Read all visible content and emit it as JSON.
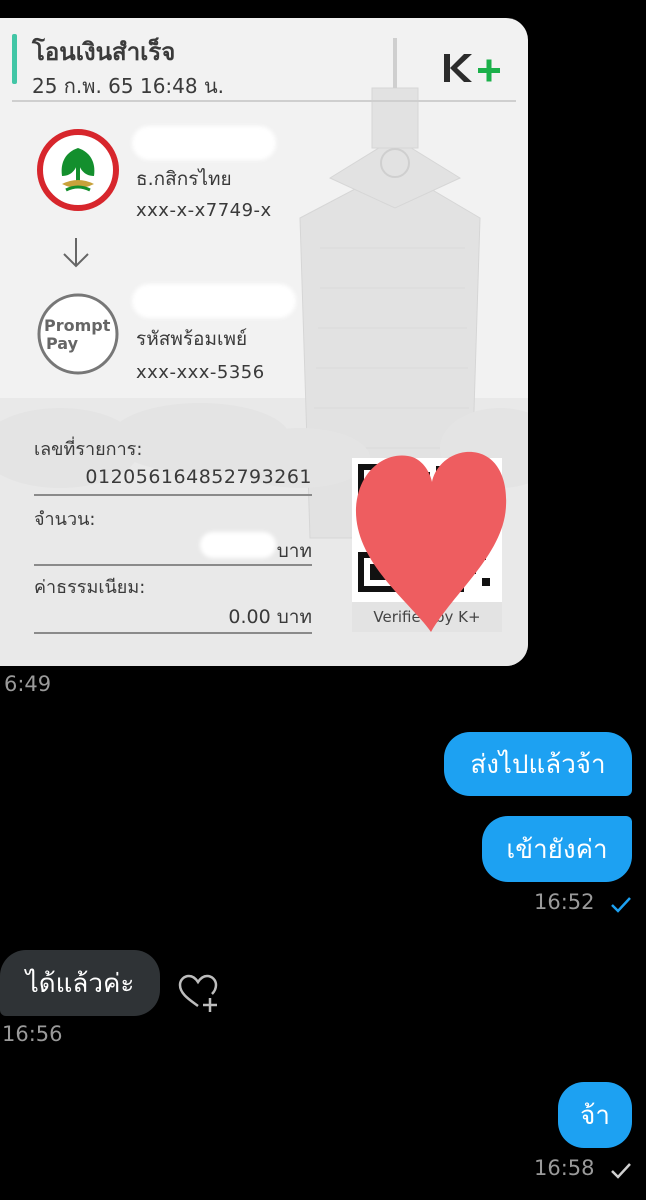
{
  "slip": {
    "title": "โอนเงินสำเร็จ",
    "datetime": "25 ก.พ. 65  16:48 น.",
    "app_logo": "K+",
    "sender": {
      "bank": "ธ.กสิกรไทย",
      "account": "xxx-x-x7749-x",
      "logo_icon": "kbank-logo-icon"
    },
    "receiver": {
      "bank": "รหัสพร้อมเพย์",
      "account": "xxx-xxx-5356",
      "logo_text_1": "Prompt",
      "logo_text_2": "Pay"
    },
    "ref_label": "เลขที่รายการ:",
    "ref_value": "012056164852793261",
    "amount_label": "จำนวน:",
    "amount_unit": "บาท",
    "fee_label": "ค่าธรรมเนียม:",
    "fee_value": "0.00 บาท",
    "verified": "Verified by K+",
    "colors": {
      "accent": "#42c6a6",
      "kbank_green": "#138f2d",
      "kbank_red": "#d7262c",
      "heart": "#ee5d60"
    }
  },
  "chat": {
    "slip_time": "6:49",
    "messages": [
      {
        "from": "me",
        "text": "ส่งไปแล้วจ้า"
      },
      {
        "from": "me",
        "text": "เข้ายังค่า"
      },
      {
        "from": "them",
        "text": "ได้แล้วค่ะ"
      },
      {
        "from": "me",
        "text": "จ้า"
      }
    ],
    "time_1": "16:52",
    "time_2": "16:56",
    "time_3": "16:58",
    "colors": {
      "outgoing": "#1da1f2",
      "incoming": "#2f3336",
      "read_check": "#1da1f2",
      "sent_check": "#cfcfcf"
    }
  }
}
